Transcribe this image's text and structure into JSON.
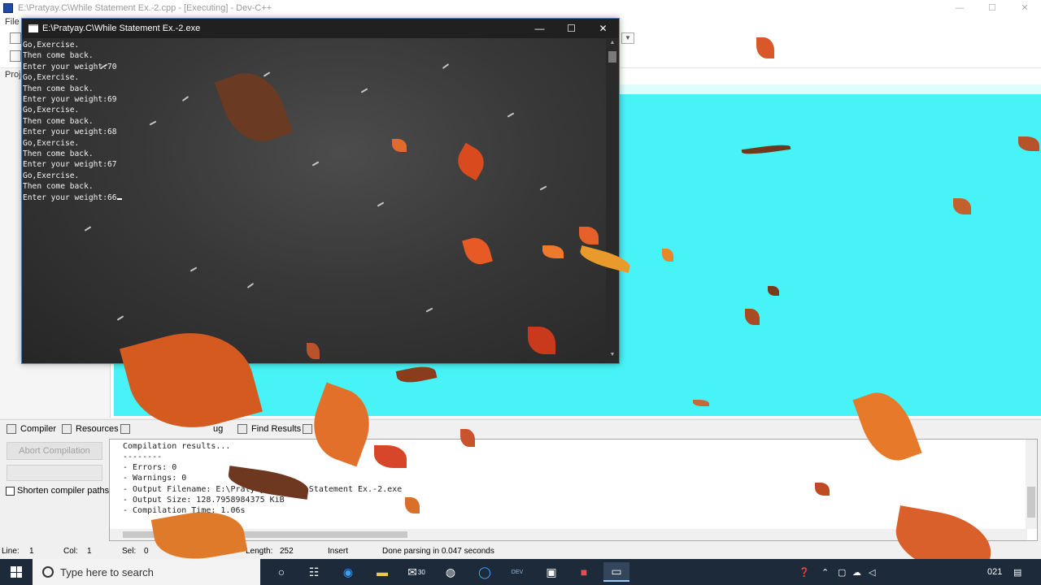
{
  "devcpp": {
    "title": "E:\\Pratyay.C\\While Statement Ex.-2.cpp - [Executing] - Dev-C++",
    "menu_first": "File",
    "project_tab": "Proje",
    "window_buttons": [
      "—",
      "☐",
      "✕"
    ]
  },
  "console": {
    "title": "E:\\Pratyay.C\\While Statement Ex.-2.exe",
    "buttons": [
      "—",
      "☐",
      "✕"
    ],
    "lines": [
      "Go,Exercise.",
      "Then come back.",
      "Enter your weight:70",
      "Go,Exercise.",
      "Then come back.",
      "Enter your weight:69",
      "Go,Exercise.",
      "Then come back.",
      "Enter your weight:68",
      "Go,Exercise.",
      "Then come back.",
      "Enter your weight:67",
      "Go,Exercise.",
      "Then come back.",
      "Enter your weight:66"
    ]
  },
  "bottom_tabs": {
    "compiler": "Compiler",
    "resources": "Resources",
    "debug": "ug",
    "find_results": "Find Results"
  },
  "compiler_panel": {
    "abort_label": "Abort Compilation",
    "shorten_label": "Shorten compiler paths",
    "log": [
      "Compilation results...",
      "--------",
      "- Errors: 0",
      "- Warnings: 0",
      "- Output Filename: E:\\Pratyay.C\\While Statement Ex.-2.exe",
      "- Output Size: 128.7958984375 KiB",
      "- Compilation Time: 1.06s"
    ]
  },
  "status_bar": {
    "line_label": "Line:",
    "line_value": "1",
    "col_label": "Col:",
    "col_value": "1",
    "sel_label": "Sel:",
    "sel_value": "0",
    "length_label": "Length:",
    "length_value": "252",
    "mode": "Insert",
    "message": "Done parsing in 0.047 seconds"
  },
  "taskbar": {
    "search_placeholder": "Type here to search",
    "mail_badge": "30",
    "clock_fragment": "021",
    "devcpp_badge": "DEV"
  },
  "colors": {
    "desktop_cyan": "#47f3f6",
    "console_bg": "#333333",
    "taskbar_bg": "#1c2a3a"
  }
}
